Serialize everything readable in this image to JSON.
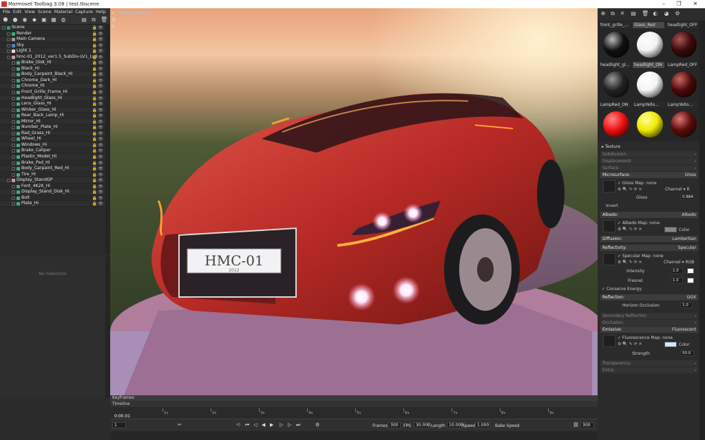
{
  "window": {
    "title": "Marmoset Toolbag 3.08  |  test.tbscene",
    "minimize": "–",
    "maximize": "❐",
    "close": "✕"
  },
  "menu": [
    "File",
    "Edit",
    "View",
    "Scene",
    "Material",
    "Capture",
    "Help"
  ],
  "outliner": {
    "items": [
      {
        "label": "Scene",
        "indent": 0,
        "icon": "#2a6"
      },
      {
        "label": "Render",
        "indent": 1,
        "icon": "#3b7"
      },
      {
        "label": "Main Camera",
        "indent": 1,
        "icon": "#999"
      },
      {
        "label": "Sky",
        "indent": 1,
        "icon": "#58b"
      },
      {
        "label": "Light 1",
        "indent": 1,
        "icon": "#ddd"
      },
      {
        "label": "hmc-01_2012_ver1.5_SubDiv-LV1_Lv8",
        "indent": 1,
        "icon": "#c9a"
      },
      {
        "label": "Brake_Disk_Hi",
        "indent": 2,
        "icon": "#4a8"
      },
      {
        "label": "Black_Hi",
        "indent": 2,
        "icon": "#4a8"
      },
      {
        "label": "Body_Carpaint_Black_Hi",
        "indent": 2,
        "icon": "#4a8"
      },
      {
        "label": "Chrome_Dark_Hi",
        "indent": 2,
        "icon": "#4a8"
      },
      {
        "label": "Chrome_Hi",
        "indent": 2,
        "icon": "#4a8"
      },
      {
        "label": "Front_Grille_Frame_Hi",
        "indent": 2,
        "icon": "#4a8"
      },
      {
        "label": "Headlight_Glass_Hi",
        "indent": 2,
        "icon": "#4a8"
      },
      {
        "label": "Lens_Glass_Hi",
        "indent": 2,
        "icon": "#4a8"
      },
      {
        "label": "Winker_Glass_Hi",
        "indent": 2,
        "icon": "#4a8"
      },
      {
        "label": "Rear_Back_Lamp_Hi",
        "indent": 2,
        "icon": "#4a8"
      },
      {
        "label": "Mirror_Hi",
        "indent": 2,
        "icon": "#4a8"
      },
      {
        "label": "Number_Plate_Hi",
        "indent": 2,
        "icon": "#4a8"
      },
      {
        "label": "Rad_Grass_Hi",
        "indent": 2,
        "icon": "#4a8"
      },
      {
        "label": "Wheel_Hi",
        "indent": 2,
        "icon": "#4a8"
      },
      {
        "label": "Windows_Hi",
        "indent": 2,
        "icon": "#4a8"
      },
      {
        "label": "Brake_Caliper",
        "indent": 2,
        "icon": "#4a8"
      },
      {
        "label": "Plastic_Model_Hi",
        "indent": 2,
        "icon": "#4a8"
      },
      {
        "label": "Brake_Pad_Hi",
        "indent": 2,
        "icon": "#4a8"
      },
      {
        "label": "Body_Carpaint_Red_Hi",
        "indent": 2,
        "icon": "#4a8"
      },
      {
        "label": "Tire_Hi",
        "indent": 2,
        "icon": "#4a8"
      },
      {
        "label": "Display_StandGP",
        "indent": 1,
        "icon": "#c9a"
      },
      {
        "label": "Font_4K2K_Hi",
        "indent": 2,
        "icon": "#4a8"
      },
      {
        "label": "Display_Stand_Disk_Hi",
        "indent": 2,
        "icon": "#4a8"
      },
      {
        "label": "Bolt",
        "indent": 2,
        "icon": "#4a8"
      },
      {
        "label": "Plate_Hi",
        "indent": 2,
        "icon": "#4a8"
      }
    ]
  },
  "properties": {
    "empty_label": "No Selection"
  },
  "viewport": {
    "camera_label": "Main Camera ▿",
    "plate_text": "HMC-01",
    "plate_sub": "2012"
  },
  "timeline": {
    "keyframes_label": "Keyframes",
    "timeline_label": "Timeline",
    "current_time": "0:00.01",
    "ticks": [
      "1s",
      "2s",
      "3s",
      "4s",
      "5s",
      "6s",
      "7s",
      "8s",
      "9s"
    ],
    "frame_field": "1",
    "frames_label": "Frames",
    "frames_value": "300",
    "fps_label": "FPS",
    "fps_value": "30.000",
    "length_label": "Length",
    "length_value": "10.000",
    "speed_label": "Speed",
    "speed_value": "1.000",
    "bake_label": "Bake Speed",
    "end_value": "300"
  },
  "materials": [
    {
      "name": "front_grille_...",
      "color": "#111",
      "highlight": "#bbb",
      "selected": false
    },
    {
      "name": "Glass_Red",
      "color": "#f2f2f2",
      "highlight": "#ffffff",
      "selected": true
    },
    {
      "name": "headlight_OFF",
      "color": "#3a0a0a",
      "highlight": "#a55",
      "selected": false
    },
    {
      "name": "headlight_gl...",
      "color": "#222",
      "highlight": "#999",
      "selected": false
    },
    {
      "name": "headlight_ON",
      "color": "#f4f4f4",
      "highlight": "#ffffff",
      "selected": true
    },
    {
      "name": "LampRed_OFF",
      "color": "#4a0a08",
      "highlight": "#c66",
      "selected": false
    },
    {
      "name": "LampRed_ON",
      "color": "#ee1111",
      "highlight": "#ff8888",
      "selected": false
    },
    {
      "name": "LampYello...",
      "color": "#f0e800",
      "highlight": "#ffff99",
      "selected": false
    },
    {
      "name": "LampYello...",
      "color": "#5a0c08",
      "highlight": "#d77",
      "selected": false
    },
    {
      "name": "",
      "color": "#222",
      "highlight": "#ccc",
      "selected": false
    },
    {
      "name": "",
      "color": "#5a0808",
      "highlight": "#e66",
      "selected": false
    },
    {
      "name": "",
      "color": "#3a3a3a",
      "highlight": "#ccc",
      "selected": false
    }
  ],
  "panel": {
    "texture": "▸ Texture",
    "subdivision": "Subdivision:",
    "displacement": "Displacement:",
    "surface": "Surface:",
    "microsurface": {
      "label": "Microsurface:",
      "mode": "Gloss",
      "map_label": "✓ Gloss Map: none",
      "channel": "Channel ▾ R",
      "gloss_label": "Gloss",
      "gloss_value": "0.884",
      "invert": "Invert"
    },
    "albedo": {
      "label": "Albedo:",
      "mode": "Albedo",
      "map_label": "✓ Albedo Map: none",
      "color_label": "Color"
    },
    "diffusion": {
      "label": "Diffusion:",
      "mode": "Lambertian"
    },
    "reflectivity": {
      "label": "Reflectivity:",
      "mode": "Specular",
      "map_label": "✓ Specular Map: none",
      "channel": "Channel ▾ RGB",
      "intensity_label": "Intensity",
      "intensity_value": "1.0",
      "fresnel_label": "Fresnel",
      "fresnel_value": "1.0",
      "conserve": "✓ Conserve Energy"
    },
    "reflection": {
      "label": "Reflection:",
      "mode": "GGX",
      "horizon_label": "Horizon Occlusion",
      "horizon_value": "1.0"
    },
    "secondary": "Secondary Reflection:",
    "occlusion": "Occlusion:",
    "emissive": {
      "label": "Emissive:",
      "mode": "Fluorescent",
      "map_label": "✓ Fluorescence Map: none",
      "color_label": "Color",
      "strength_label": "Strength",
      "strength_value": "50.0"
    },
    "transparency": "Transparency:",
    "extra": "Extra:",
    "dash": "-"
  },
  "colors": {
    "accent": "#9ecbff",
    "albedo_swatch": "#888888",
    "emissive_swatch": "#cfe8ff"
  }
}
